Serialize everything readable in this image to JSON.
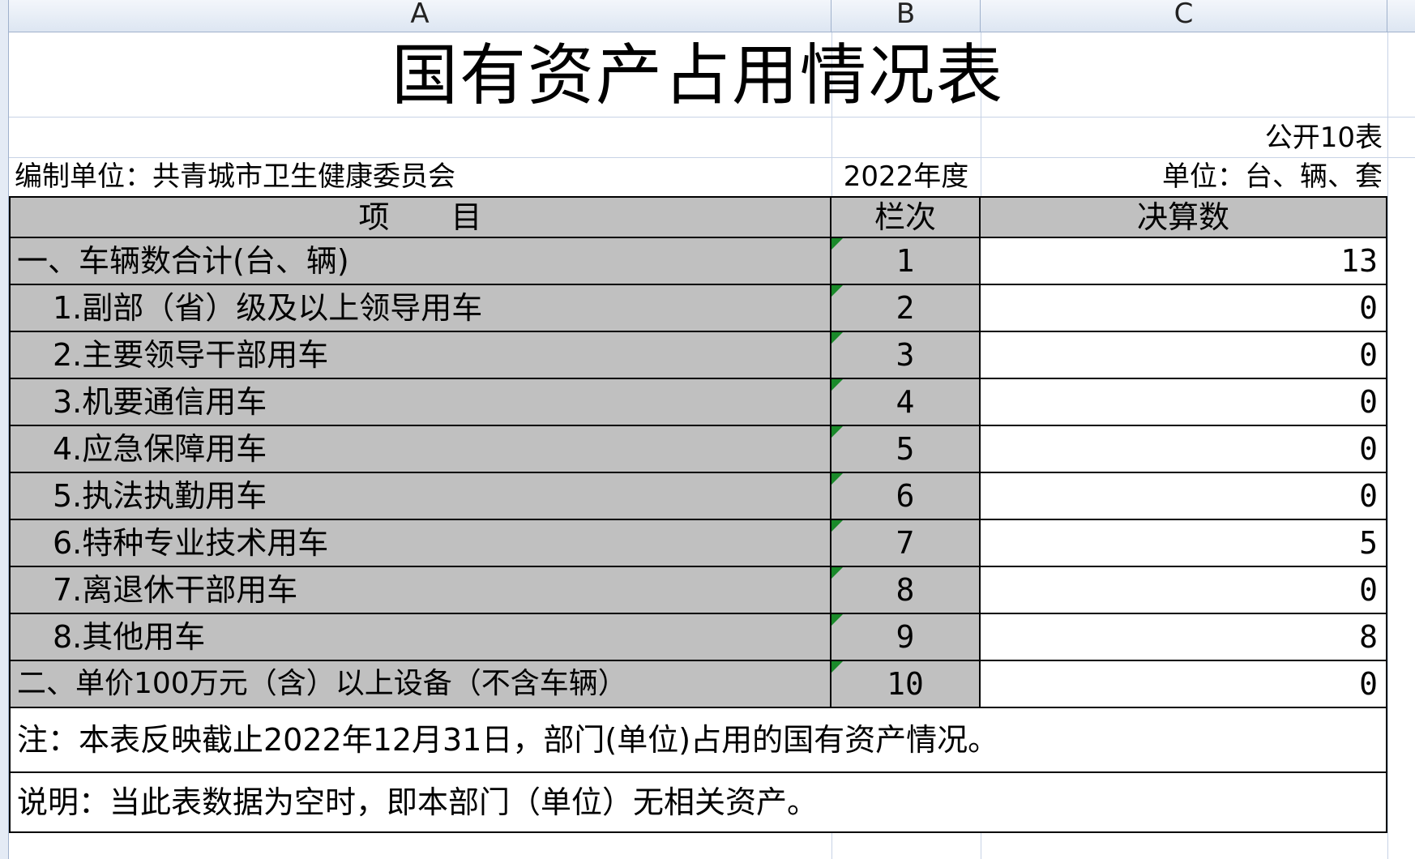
{
  "column_headers": [
    "A",
    "B",
    "C"
  ],
  "title": "国有资产占用情况表",
  "form_id": "公开10表",
  "compiler": "编制单位：共青城市卫生健康委员会",
  "year": "2022年度",
  "unit": "单位：台、辆、套",
  "table": {
    "headers": [
      "项　　目",
      "栏次",
      "决算数"
    ],
    "rows": [
      {
        "item": "一、车辆数合计(台、辆)",
        "seq": "1",
        "value": "13"
      },
      {
        "item": "1.副部（省）级及以上领导用车",
        "seq": "2",
        "value": "0"
      },
      {
        "item": "2.主要领导干部用车",
        "seq": "3",
        "value": "0"
      },
      {
        "item": "3.机要通信用车",
        "seq": "4",
        "value": "0"
      },
      {
        "item": "4.应急保障用车",
        "seq": "5",
        "value": "0"
      },
      {
        "item": "5.执法执勤用车",
        "seq": "6",
        "value": "0"
      },
      {
        "item": "6.特种专业技术用车",
        "seq": "7",
        "value": "5"
      },
      {
        "item": "7.离退休干部用车",
        "seq": "8",
        "value": "0"
      },
      {
        "item": "8.其他用车",
        "seq": "9",
        "value": "8"
      },
      {
        "item": "二、单价100万元（含）以上设备（不含车辆）",
        "seq": "10",
        "value": "0"
      }
    ]
  },
  "note": "注：本表反映截止2022年12月31日，部门(单位)占用的国有资产情况。",
  "explanation": "说明：当此表数据为空时，即本部门（单位）无相关资产。",
  "colors": {
    "header_fill": "#c0c0c0",
    "comment_marker": "#1a8a2a",
    "grid": "#c7d3e6"
  }
}
